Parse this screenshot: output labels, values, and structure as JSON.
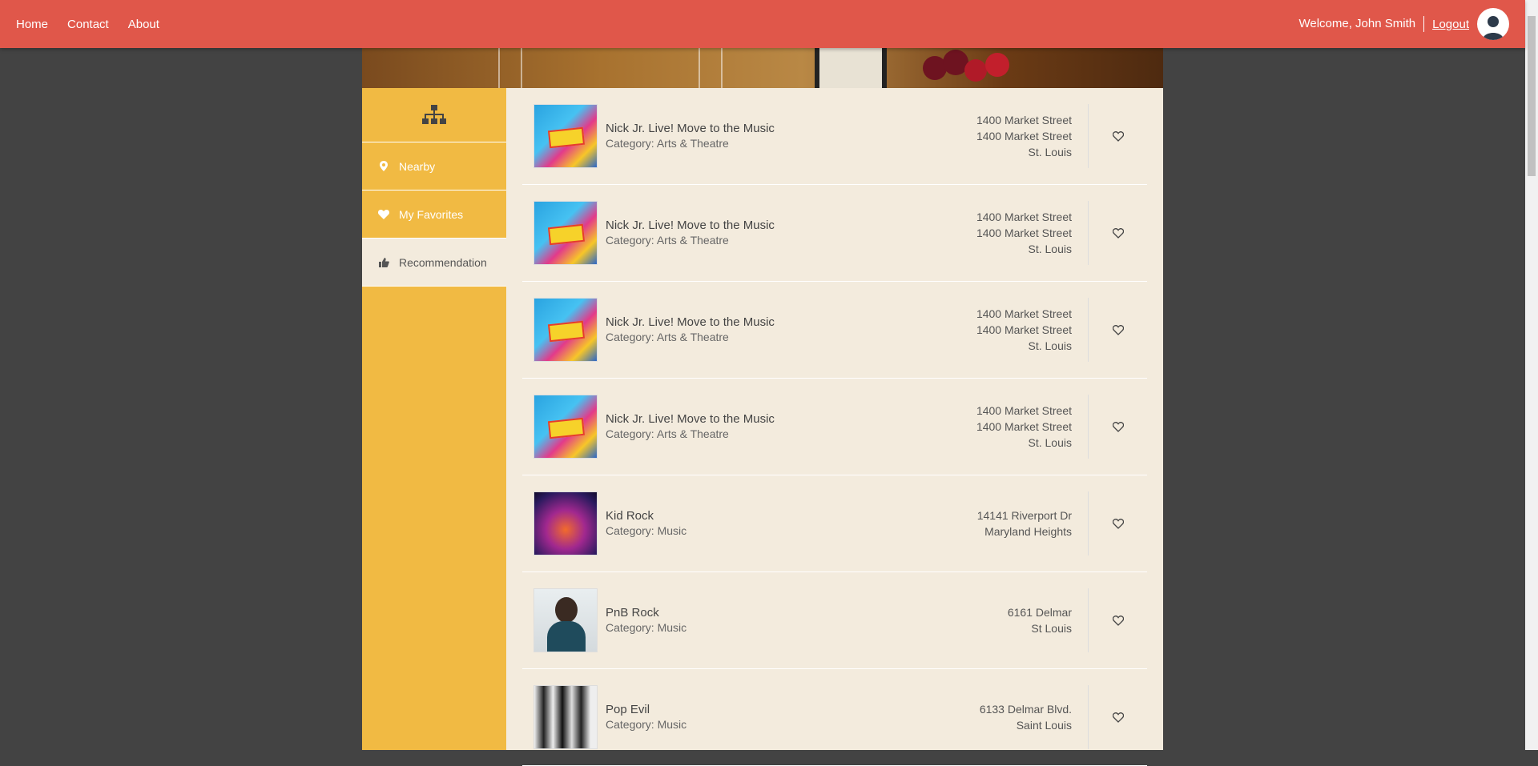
{
  "nav": {
    "links": [
      "Home",
      "Contact",
      "About"
    ],
    "welcome": "Welcome, John Smith",
    "logout": "Logout"
  },
  "sidebar": {
    "head_icon": "sitemap-icon",
    "items": [
      {
        "label": "Nearby",
        "icon": "map-marker-icon"
      },
      {
        "label": "My Favorites",
        "icon": "heart-icon"
      },
      {
        "label": "Recommendation",
        "icon": "thumbs-up-icon",
        "active": true
      }
    ]
  },
  "items": [
    {
      "title": "Nick Jr. Live! Move to the Music",
      "category": "Category: Arts & Theatre",
      "address": [
        "1400 Market Street",
        "1400 Market Street",
        "St. Louis"
      ],
      "image": "nick-jr-live-poster"
    },
    {
      "title": "Nick Jr. Live! Move to the Music",
      "category": "Category: Arts & Theatre",
      "address": [
        "1400 Market Street",
        "1400 Market Street",
        "St. Louis"
      ],
      "image": "nick-jr-live-poster"
    },
    {
      "title": "Nick Jr. Live! Move to the Music",
      "category": "Category: Arts & Theatre",
      "address": [
        "1400 Market Street",
        "1400 Market Street",
        "St. Louis"
      ],
      "image": "nick-jr-live-poster"
    },
    {
      "title": "Nick Jr. Live! Move to the Music",
      "category": "Category: Arts & Theatre",
      "address": [
        "1400 Market Street",
        "1400 Market Street",
        "St. Louis"
      ],
      "image": "nick-jr-live-poster"
    },
    {
      "title": "Kid Rock",
      "category": "Category: Music",
      "address": [
        "14141 Riverport Dr",
        "Maryland Heights"
      ],
      "image": "kid-rock-concert-photo"
    },
    {
      "title": "PnB Rock",
      "category": "Category: Music",
      "address": [
        "6161 Delmar",
        "St Louis"
      ],
      "image": "pnb-rock-portrait"
    },
    {
      "title": "Pop Evil",
      "category": "Category: Music",
      "address": [
        "6133 Delmar Blvd.",
        "Saint Louis"
      ],
      "image": "pop-evil-band-photo"
    }
  ],
  "colors": {
    "nav_bg": "#e0574a",
    "sidebar_bg": "#f1ba43",
    "content_bg": "#f3ebdd",
    "page_bg": "#434343"
  }
}
